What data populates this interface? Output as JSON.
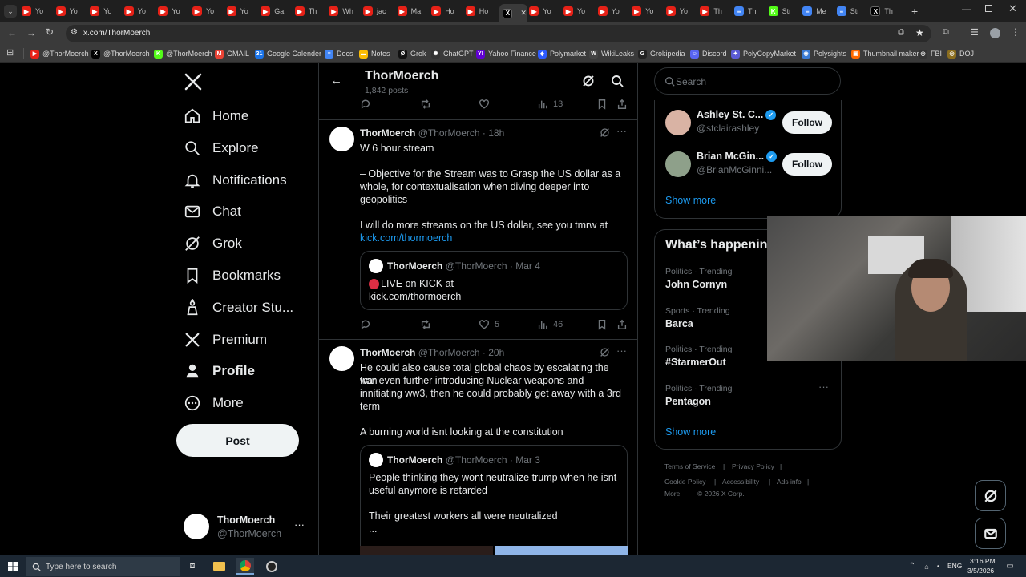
{
  "browser": {
    "tabs": [
      {
        "label": "Yo",
        "icon": "youtube-icon"
      },
      {
        "label": "Yo",
        "icon": "youtube-icon"
      },
      {
        "label": "Yo",
        "icon": "youtube-icon"
      },
      {
        "label": "Yo",
        "icon": "youtube-icon"
      },
      {
        "label": "Yo",
        "icon": "youtube-icon"
      },
      {
        "label": "Yo",
        "icon": "youtube-icon"
      },
      {
        "label": "Yo",
        "icon": "youtube-icon"
      },
      {
        "label": "Ga",
        "icon": "youtube-icon"
      },
      {
        "label": "Th",
        "icon": "youtube-icon"
      },
      {
        "label": "Wh",
        "icon": "youtube-icon"
      },
      {
        "label": "jac",
        "icon": "youtube-icon"
      },
      {
        "label": "Ma",
        "icon": "youtube-icon"
      },
      {
        "label": "Ho",
        "icon": "youtube-icon"
      },
      {
        "label": "Ho",
        "icon": "youtube-icon"
      },
      {
        "label": "",
        "icon": "x-icon",
        "active": true
      },
      {
        "label": "Yo",
        "icon": "youtube-icon"
      },
      {
        "label": "Yo",
        "icon": "youtube-icon"
      },
      {
        "label": "Yo",
        "icon": "youtube-icon"
      },
      {
        "label": "Yo",
        "icon": "youtube-icon"
      },
      {
        "label": "Yo",
        "icon": "youtube-icon"
      },
      {
        "label": "Th",
        "icon": "youtube-icon"
      },
      {
        "label": "Th",
        "icon": "docs-icon"
      },
      {
        "label": "Str",
        "icon": "kick-icon"
      },
      {
        "label": "Me",
        "icon": "docs-icon"
      },
      {
        "label": "Str",
        "icon": "docs-icon"
      },
      {
        "label": "Th",
        "icon": "x-icon"
      }
    ],
    "url": "x.com/ThorMoerch",
    "bookmarks": [
      {
        "label": "@ThorMoerch",
        "icon": "youtube-icon"
      },
      {
        "label": "@ThorMoerch",
        "icon": "x-icon"
      },
      {
        "label": "@ThorMoerch",
        "icon": "kick-icon"
      },
      {
        "label": "GMAIL",
        "icon": "gmail-icon"
      },
      {
        "label": "Google Calender",
        "icon": "calendar-icon"
      },
      {
        "label": "Docs",
        "icon": "docs-icon"
      },
      {
        "label": "Notes",
        "icon": "notes-icon"
      },
      {
        "label": "Grok",
        "icon": "grok-icon"
      },
      {
        "label": "ChatGPT",
        "icon": "chatgpt-icon"
      },
      {
        "label": "Yahoo Finance",
        "icon": "yahoo-icon"
      },
      {
        "label": "Polymarket",
        "icon": "polymarket-icon"
      },
      {
        "label": "WikiLeaks",
        "icon": "wikileaks-icon"
      },
      {
        "label": "Grokipedia",
        "icon": "grokipedia-icon"
      },
      {
        "label": "Discord",
        "icon": "discord-icon"
      },
      {
        "label": "PolyCopyMarket",
        "icon": "polycopy-icon"
      },
      {
        "label": "Polysights",
        "icon": "polysights-icon"
      },
      {
        "label": "Thumbnail maker",
        "icon": "thumbnail-icon"
      },
      {
        "label": "FBI",
        "icon": "fbi-icon"
      },
      {
        "label": "DOJ",
        "icon": "doj-icon"
      }
    ]
  },
  "sidebar": {
    "items": [
      {
        "label": "Home",
        "icon": "home-icon"
      },
      {
        "label": "Explore",
        "icon": "search-icon"
      },
      {
        "label": "Notifications",
        "icon": "bell-icon"
      },
      {
        "label": "Chat",
        "icon": "mail-icon"
      },
      {
        "label": "Grok",
        "icon": "grok-icon"
      },
      {
        "label": "Bookmarks",
        "icon": "bookmark-icon"
      },
      {
        "label": "Creator Stu...",
        "icon": "creator-studio-icon"
      },
      {
        "label": "Premium",
        "icon": "x-icon"
      },
      {
        "label": "Profile",
        "icon": "person-icon"
      },
      {
        "label": "More",
        "icon": "more-circle-icon"
      }
    ],
    "post_label": "Post",
    "account": {
      "name": "ThorMoerch",
      "handle": "@ThorMoerch"
    }
  },
  "header": {
    "name": "ThorMoerch",
    "posts": "1,842 posts"
  },
  "top_actions": {
    "views": "13"
  },
  "tweets": [
    {
      "name": "ThorMoerch",
      "handle": "@ThorMoerch",
      "time": "· 18h",
      "lines": [
        "W 6 hour stream",
        "",
        "– Objective for the Stream was to Grasp the US dollar as a",
        "whole, for contextualisation when diving deeper into",
        "geopolitics",
        "",
        "I will do more streams on the US dollar, see you tmrw at"
      ],
      "link": "kick.com/thormoerch",
      "quote": {
        "name": "ThorMoerch",
        "handle": "@ThorMoerch",
        "time": "· Mar 4",
        "line1": "LIVE on KICK at",
        "line2": "kick.com/thormoerch"
      },
      "likes": "5",
      "views": "46"
    },
    {
      "name": "ThorMoerch",
      "handle": "@ThorMoerch",
      "time": "· 20h",
      "lines": [
        "He could also cause total global chaos by escalating the Iran",
        "war even further introducing Nuclear weapons and",
        "innitiating ww3, then he could probably get away with a 3rd",
        "term",
        "",
        "A burning world isnt looking at the constitution"
      ],
      "quote": {
        "name": "ThorMoerch",
        "handle": "@ThorMoerch",
        "time": "· Mar 3",
        "lines": [
          "People thinking they wont neutralize trump when he isnt",
          "useful anymore is retarded",
          "",
          "Their greatest workers all were neutralized",
          "..."
        ]
      }
    }
  ],
  "right": {
    "search_placeholder": "Search",
    "who_to_follow": [
      {
        "name": "Ashley St. C...",
        "handle": "@stclairashley",
        "button": "Follow"
      },
      {
        "name": "Brian McGin...",
        "handle": "@BrianMcGinni...",
        "button": "Follow"
      }
    ],
    "show_more": "Show more",
    "happening_title": "What’s happenin",
    "trends": [
      {
        "category": "Politics · Trending",
        "name": "John Cornyn"
      },
      {
        "category": "Sports · Trending",
        "name": "Barca"
      },
      {
        "category": "Politics · Trending",
        "name": "#StarmerOut"
      },
      {
        "category": "Politics · Trending",
        "name": "Pentagon"
      }
    ],
    "show_more_2": "Show more",
    "footer": {
      "terms": "Terms of Service",
      "privacy": "Privacy Policy",
      "cookie": "Cookie Policy",
      "accessibility": "Accessibility",
      "ads": "Ads info",
      "more": "More ···",
      "copyright": "© 2026 X Corp."
    }
  },
  "taskbar": {
    "search_placeholder": "Type here to search",
    "lang": "ENG",
    "time": "3:16 PM",
    "date": "3/5/2026"
  },
  "colors": {
    "accent": "#1d9bf0",
    "background": "#000000",
    "border": "#2f3336",
    "muted": "#71767b",
    "youtube": "#e62117"
  }
}
